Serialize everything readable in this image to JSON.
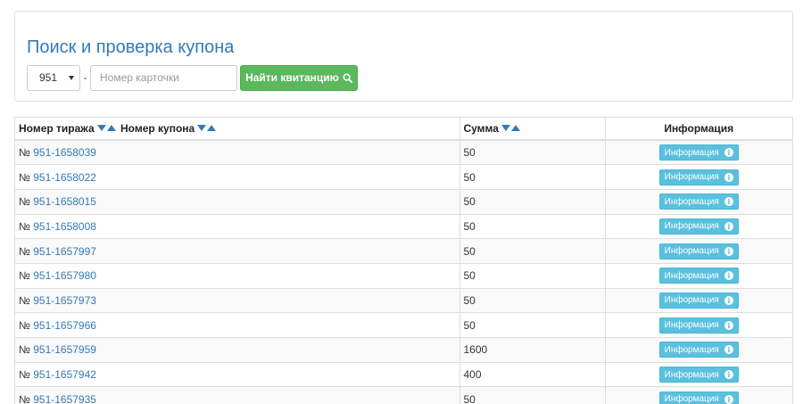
{
  "search": {
    "title": "Поиск и проверка купона",
    "series_value": "951",
    "separator": "-",
    "card_placeholder": "Номер карточки",
    "find_button_label": "Найти квитанцию",
    "find_icon": "search-icon"
  },
  "table": {
    "headers": {
      "draw": "Номер тиража",
      "coupon": "Номер купона",
      "sum": "Сумма",
      "info": "Информация"
    },
    "sort_icons": [
      "sort-desc-icon",
      "sort-asc-icon"
    ],
    "row_prefix": "№",
    "info_button_label": "Информация",
    "info_icon": "info-icon",
    "rows": [
      {
        "coupon": "951-1658039",
        "sum": "50"
      },
      {
        "coupon": "951-1658022",
        "sum": "50"
      },
      {
        "coupon": "951-1658015",
        "sum": "50"
      },
      {
        "coupon": "951-1658008",
        "sum": "50"
      },
      {
        "coupon": "951-1657997",
        "sum": "50"
      },
      {
        "coupon": "951-1657980",
        "sum": "50"
      },
      {
        "coupon": "951-1657973",
        "sum": "50"
      },
      {
        "coupon": "951-1657966",
        "sum": "50"
      },
      {
        "coupon": "951-1657959",
        "sum": "1600"
      },
      {
        "coupon": "951-1657942",
        "sum": "400"
      },
      {
        "coupon": "951-1657935",
        "sum": "50"
      }
    ]
  },
  "colors": {
    "link": "#337ab7",
    "success": "#5cb85c",
    "info": "#5bc0de"
  }
}
